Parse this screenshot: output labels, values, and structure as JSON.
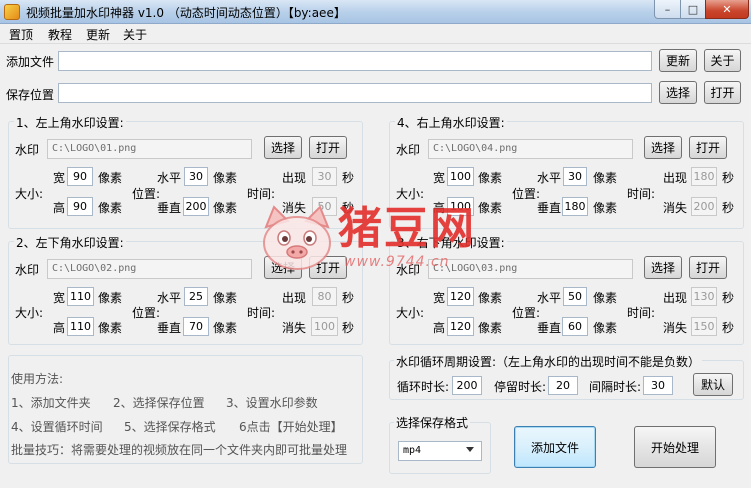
{
  "window": {
    "title": "视频批量加水印神器 v1.0 （动态时间动态位置）【by:aee】",
    "min_glyph": "–",
    "max_glyph": "□",
    "close_glyph": "✕"
  },
  "menu": [
    "置顶",
    "教程",
    "更新",
    "关于"
  ],
  "add_file": {
    "label": "添加文件",
    "value": "",
    "btn_update": "更新",
    "btn_about": "关于"
  },
  "save_path": {
    "label": "保存位置",
    "value": "",
    "btn_choose": "选择",
    "btn_open": "打开"
  },
  "common": {
    "watermark": "水印",
    "choose": "选择",
    "open": "打开",
    "width": "宽",
    "height": "高",
    "size": "大小:",
    "horizontal": "水平",
    "vertical": "垂直",
    "position": "位置:",
    "pixel": "像素",
    "appear": "出现",
    "disappear": "消失",
    "time": "时间:",
    "second": "秒"
  },
  "groups": [
    {
      "title": "1、左上角水印设置:",
      "path": "C:\\LOGO\\01.png",
      "width": "90",
      "height": "90",
      "h": "30",
      "v": "200",
      "appear": "30",
      "disappear": "50"
    },
    {
      "title": "4、右上角水印设置:",
      "path": "C:\\LOGO\\04.png",
      "width": "100",
      "height": "100",
      "h": "30",
      "v": "180",
      "appear": "180",
      "disappear": "200"
    },
    {
      "title": "2、左下角水印设置:",
      "path": "C:\\LOGO\\02.png",
      "width": "110",
      "height": "110",
      "h": "25",
      "v": "70",
      "appear": "80",
      "disappear": "100"
    },
    {
      "title": "3、右下角水印设置:",
      "path": "C:\\LOGO\\03.png",
      "width": "120",
      "height": "120",
      "h": "50",
      "v": "60",
      "appear": "130",
      "disappear": "150"
    }
  ],
  "usage": {
    "title": "使用方法:",
    "steps1": [
      "1、添加文件夹",
      "2、选择保存位置",
      "3、设置水印参数"
    ],
    "steps2": [
      "4、设置循环时间",
      "5、选择保存格式",
      "6点击【开始处理】"
    ],
    "tip": "批量技巧：将需要处理的视频放在同一个文件夹内即可批量处理"
  },
  "cycle": {
    "title": "水印循环周期设置:（左上角水印的出现时间不能是负数）",
    "loop_label": "循环时长:",
    "loop_value": "200",
    "stay_label": "停留时长:",
    "stay_value": "20",
    "gap_label": "间隔时长:",
    "gap_value": "30",
    "default_btn": "默认"
  },
  "format": {
    "title": "选择保存格式",
    "selected": "mp4"
  },
  "actions": {
    "add_file": "添加文件",
    "start": "开始处理"
  },
  "watermark_overlay": {
    "brand": "猪豆网",
    "url": "www.9744.cn"
  }
}
